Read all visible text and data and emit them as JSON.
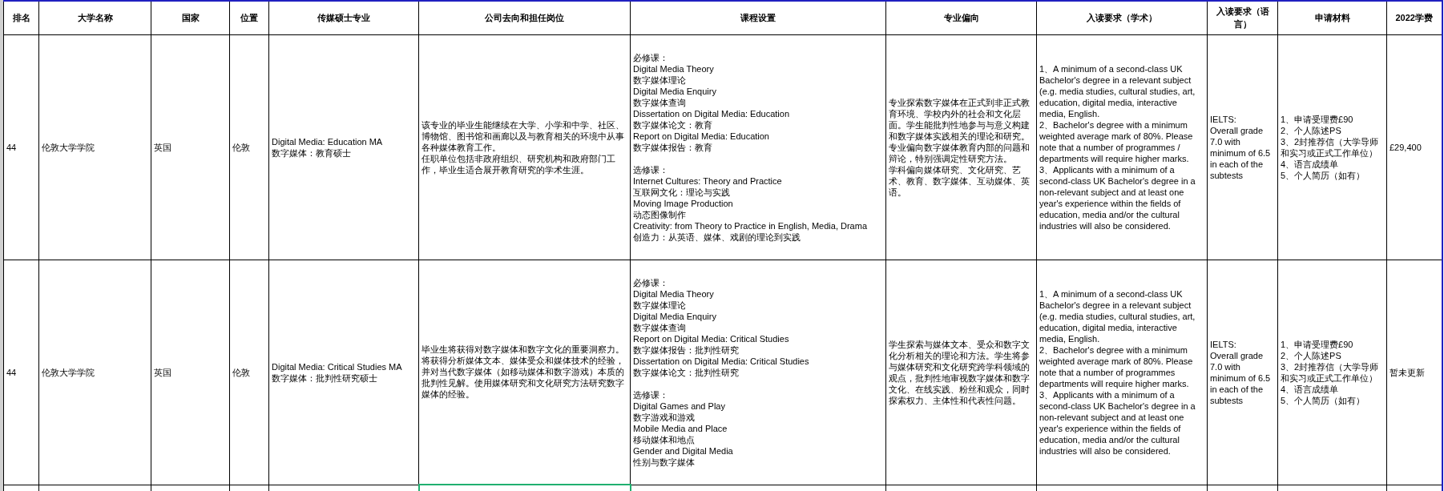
{
  "table": {
    "columns": [
      "排名",
      "大学名称",
      "国家",
      "位置",
      "传媒硕士专业",
      "公司去向和担任岗位",
      "课程设置",
      "专业偏向",
      "入读要求（学术）",
      "入读要求（语言）",
      "申请材料",
      "2022学费"
    ],
    "rows": [
      {
        "cells": [
          [
            [
              "44"
            ]
          ],
          [
            [
              "伦敦大学学院"
            ]
          ],
          [
            [
              "英国"
            ]
          ],
          [
            [
              "伦敦"
            ]
          ],
          [
            [
              "Digital Media: Education MA",
              "数字媒体：教育硕士"
            ]
          ],
          [
            [
              "该专业的毕业生能继续在大学、小学和中学、社区、博物馆、图书馆和画廊以及与教育相关的环境中从事各种媒体教育工作。",
              "任职单位包括非政府组织、研究机构和政府部门工作，毕业生适合展开教育研究的学术生涯。"
            ]
          ],
          [
            [
              "必修课：",
              "Digital Media Theory",
              "数字媒体理论",
              "Digital Media Enquiry",
              "数字媒体查询",
              "Dissertation on Digital Media: Education",
              "数字媒体论文：教育",
              "Report on Digital Media: Education",
              "数字媒体报告：教育"
            ],
            [
              "选修课：",
              "Internet Cultures: Theory and Practice",
              "互联网文化：理论与实践",
              "Moving Image Production",
              "动态图像制作",
              "Creativity: from Theory to Practice in English, Media, Drama",
              "创造力：从英语、媒体、戏剧的理论到实践"
            ]
          ],
          [
            [
              "专业探索数字媒体在正式到非正式教育环境、学校内外的社会和文化层面。学生能批判性地参与与意义构建和数字媒体实践相关的理论和研究。",
              "专业偏向数字媒体教育内部的问题和辩论，特别强调定性研究方法。",
              "学科偏向媒体研究、文化研究、艺术、教育、数字媒体、互动媒体、英语。"
            ]
          ],
          [
            [
              "1、A minimum of a second-class UK Bachelor's degree in a relevant subject (e.g. media studies, cultural studies, art, education, digital media, interactive media, English.",
              "2、Bachelor's degree with a minimum weighted average mark of 80%. Please note that a number of programmes / departments will require higher marks.",
              "3、Applicants with a minimum of a second-class UK Bachelor's degree in a non-relevant subject and at least one year's experience within the fields of education, media and/or the cultural industries will also be considered."
            ]
          ],
          [
            [
              "IELTS:",
              "Overall grade 7.0 with minimum of 6.5 in each of the subtests"
            ]
          ],
          [
            [
              "1、申请受理费£90",
              "2、个人陈述PS",
              "3、2封推荐信（大学导师和实习或正式工作单位）",
              "4、语言成绩单",
              "5、个人简历（如有）"
            ]
          ],
          [
            [
              "£29,400"
            ]
          ]
        ]
      },
      {
        "cells": [
          [
            [
              "44"
            ]
          ],
          [
            [
              "伦敦大学学院"
            ]
          ],
          [
            [
              "英国"
            ]
          ],
          [
            [
              "伦敦"
            ]
          ],
          [
            [
              "Digital Media: Critical Studies MA",
              "数字媒体：批判性研究硕士"
            ]
          ],
          [
            [
              "毕业生将获得对数字媒体和数字文化的重要洞察力。将获得分析媒体文本、媒体受众和媒体技术的经验，并对当代数字媒体（如移动媒体和数字游戏）本质的批判性见解。使用媒体研究和文化研究方法研究数字媒体的经验。"
            ]
          ],
          [
            [
              "必修课：",
              "Digital Media Theory",
              "数字媒体理论",
              "Digital Media Enquiry",
              "数字媒体查询",
              "Report on Digital Media: Critical Studies",
              "数字媒体报告：批判性研究",
              "Dissertation on Digital Media: Critical Studies",
              "数字媒体论文：批判性研究"
            ],
            [
              "选修课：",
              "Digital Games and Play",
              "数字游戏和游戏",
              "Mobile Media and Place",
              "移动媒体和地点",
              "Gender and Digital Media",
              "性别与数字媒体"
            ]
          ],
          [
            [
              "学生探索与媒体文本、受众和数字文化分析相关的理论和方法。学生将参与媒体研究和文化研究跨学科领域的观点，批判性地审视数字媒体和数字文化、在线实践、粉丝和观众，同时探索权力、主体性和代表性问题。"
            ]
          ],
          [
            [
              "1、A minimum of a second-class UK Bachelor's degree in a relevant subject (e.g. media studies, cultural studies, art, education, digital media, interactive media, English.",
              "2、Bachelor's degree with a minimum weighted average mark of 80%. Please note that a number of programmes departments will require higher marks.",
              "3、Applicants with a minimum of a second-class UK Bachelor's degree in a non-relevant subject and at least one year's experience within the fields of education, media and/or the cultural industries will also be considered."
            ]
          ],
          [
            [
              "IELTS:",
              "Overall grade 7.0 with minimum of 6.5 in each of the subtests"
            ]
          ],
          [
            [
              "1、申请受理费£90",
              "2、个人陈述PS",
              "3、2封推荐信（大学导师和实习或正式工作单位）",
              "4、语言成绩单",
              "5、个人简历（如有）"
            ]
          ],
          [
            [
              "暂未更新"
            ]
          ]
        ]
      }
    ]
  }
}
